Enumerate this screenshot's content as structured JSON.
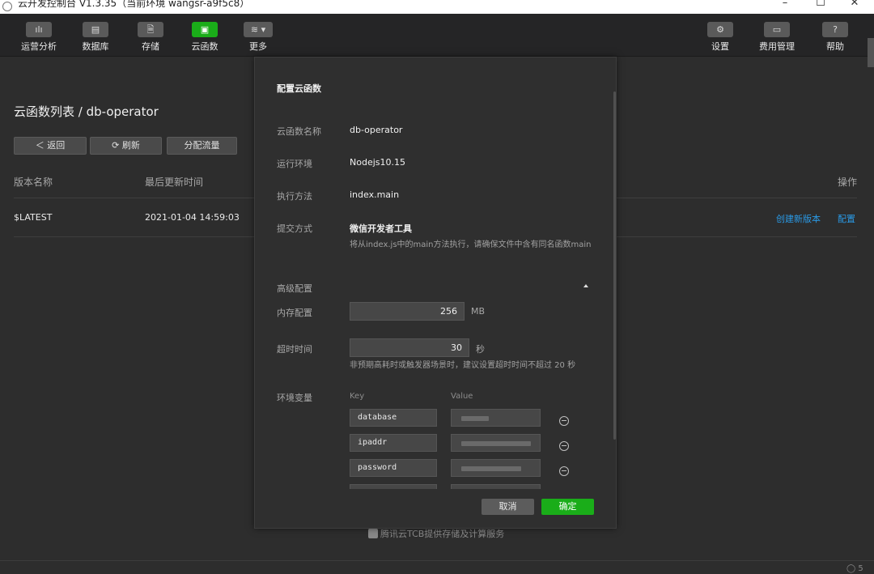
{
  "window": {
    "title": "云开发控制台 V1.3.35（当前环境 wangsr-a9f5c8）",
    "minimize": "–",
    "maximize": "☐",
    "close": "✕"
  },
  "toolbar": {
    "left": [
      {
        "label": "运营分析",
        "icon": "chart-icon",
        "glyph": "ılı"
      },
      {
        "label": "数据库",
        "icon": "database-icon",
        "glyph": "▤"
      },
      {
        "label": "存储",
        "icon": "storage-icon",
        "glyph": "🗎"
      },
      {
        "label": "云函数",
        "icon": "cloud-function-icon",
        "glyph": "▣",
        "active": true
      },
      {
        "label": "更多",
        "icon": "layers-icon",
        "glyph": "≋ ▾"
      }
    ],
    "right": [
      {
        "label": "设置",
        "icon": "gear-icon",
        "glyph": "⚙"
      },
      {
        "label": "费用管理",
        "icon": "billing-icon",
        "glyph": "▭"
      },
      {
        "label": "帮助",
        "icon": "help-icon",
        "glyph": "?"
      }
    ],
    "accent": "#1aad19"
  },
  "page": {
    "title": "云函数列表 / db-operator",
    "buttons": {
      "back": "＜ 返回",
      "refresh": "⟳ 刷新",
      "allocate": "分配流量"
    },
    "columns": {
      "name": "版本名称",
      "updated": "最后更新时间",
      "actions": "操作"
    },
    "rows": [
      {
        "name": "$LATEST",
        "updated": "2021-01-04 14:59:03",
        "action_new": "创建新版本",
        "action_config": "配置"
      }
    ],
    "link_color": "#2a9ae6"
  },
  "footer": {
    "text": "腾讯云TCB提供存储及计算服务",
    "corner": "◯ 5"
  },
  "modal": {
    "title": "配置云函数",
    "fields": {
      "name_label": "云函数名称",
      "name_value": "db-operator",
      "runtime_label": "运行环境",
      "runtime_value": "Nodejs10.15",
      "handler_label": "执行方法",
      "handler_value": "index.main",
      "submit_label": "提交方式",
      "submit_value": "微信开发者工具",
      "submit_hint": "将从index.js中的main方法执行，请确保文件中含有同名函数main"
    },
    "advanced": {
      "label": "高级配置",
      "memory_label": "内存配置",
      "memory_value": "256",
      "memory_unit": "MB",
      "timeout_label": "超时时间",
      "timeout_value": "30",
      "timeout_unit": "秒",
      "timeout_hint": "非预期高耗时或触发器场景时，建议设置超时时间不超过 20 秒"
    },
    "env": {
      "label": "环境变量",
      "key_header": "Key",
      "value_header": "Value",
      "rows": [
        {
          "key": "database"
        },
        {
          "key": "ipaddr"
        },
        {
          "key": "password"
        }
      ]
    },
    "buttons": {
      "cancel": "取消",
      "ok": "确定"
    }
  }
}
